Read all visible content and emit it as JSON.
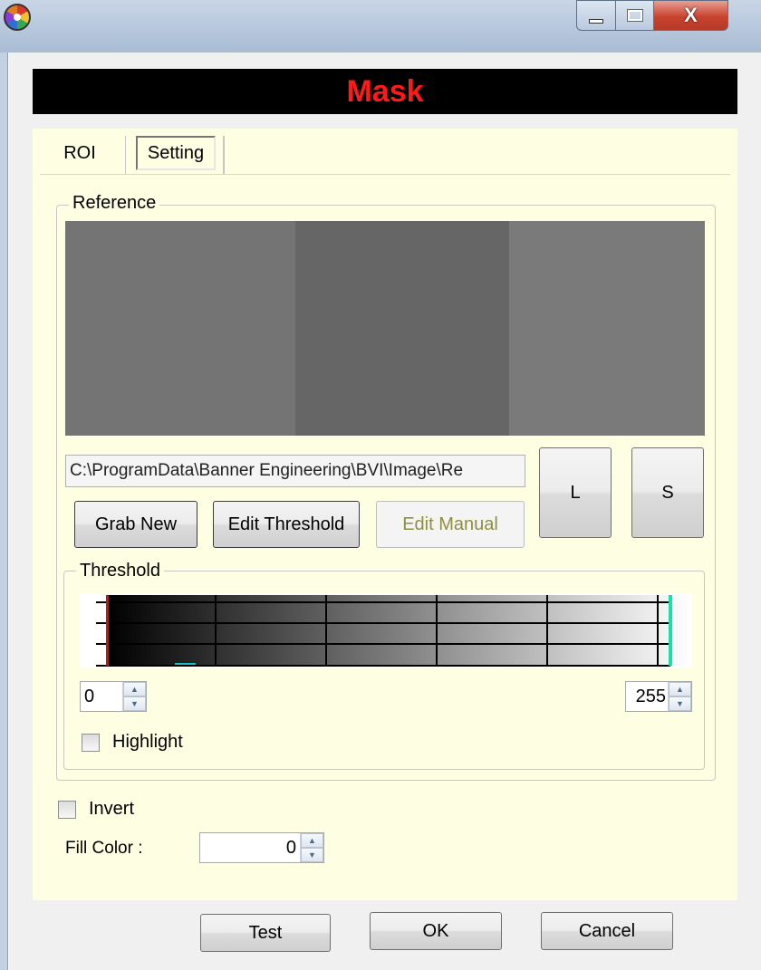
{
  "window": {
    "icon": "app-logo-icon",
    "controls": {
      "minimize": "minimize-icon",
      "maximize": "maximize-icon",
      "close": "close-icon",
      "close_glyph": "X"
    }
  },
  "header": {
    "title": "Mask",
    "title_color": "#ff1a1a"
  },
  "tabs": [
    {
      "label": "ROI",
      "selected": false
    },
    {
      "label": "Setting",
      "selected": true
    }
  ],
  "reference": {
    "legend": "Reference",
    "image_tones": [
      "#747474",
      "#666666",
      "#7a7a7a"
    ],
    "path": "C:\\ProgramData\\Banner Engineering\\BVI\\Image\\Re",
    "buttons": {
      "grab_new": "Grab New",
      "edit_threshold": "Edit Threshold",
      "edit_manual": "Edit Manual",
      "load": "L",
      "save": "S"
    }
  },
  "threshold": {
    "legend": "Threshold",
    "min": "0",
    "max": "255",
    "highlight_label": "Highlight",
    "highlight_checked": false,
    "min_marker_color": "#d01010",
    "max_marker_color": "#19e0a8"
  },
  "invert": {
    "label": "Invert",
    "checked": false
  },
  "fill_color": {
    "label": "Fill Color :",
    "value": "0"
  },
  "footer": {
    "test": "Test",
    "ok": "OK",
    "cancel": "Cancel"
  }
}
